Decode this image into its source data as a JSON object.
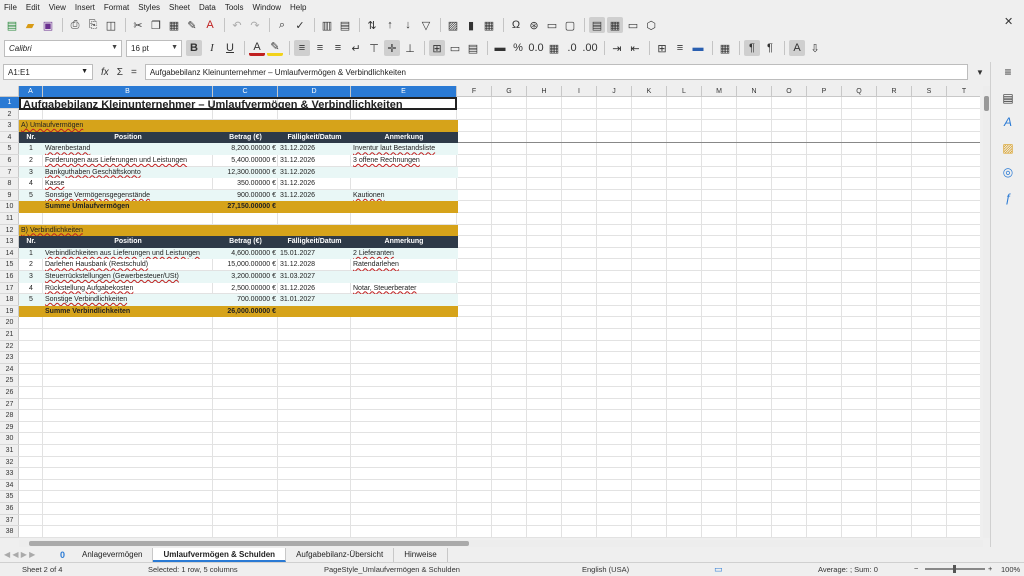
{
  "menu": [
    "File",
    "Edit",
    "View",
    "Insert",
    "Format",
    "Styles",
    "Sheet",
    "Data",
    "Tools",
    "Window",
    "Help"
  ],
  "toolbar": {
    "font_name": "Calibri",
    "font_size": "16 pt"
  },
  "formula_bar": {
    "name_box": "A1:E1",
    "fx_label": "fx",
    "sum_label": "Σ",
    "eq_label": "=",
    "content": "Aufgabebilanz Kleinunternehmer – Umlaufvermögen & Verbindlichkeiten"
  },
  "columns": [
    "A",
    "B",
    "C",
    "D",
    "E",
    "F",
    "G",
    "H",
    "I",
    "J",
    "K",
    "L",
    "M",
    "N",
    "O",
    "P",
    "Q",
    "R",
    "S",
    "T"
  ],
  "rows_count": 38,
  "sheet": {
    "title": "Aufgabebilanz Kleinunternehmer – Umlaufvermögen & Verbindlichkeiten",
    "sectionA": "A) Umlaufvermögen",
    "sectionB": "B) Verbindlichkeiten",
    "headers": [
      "Nr.",
      "Position",
      "Betrag (€)",
      "Fälligkeit/Datum",
      "Anmerkung"
    ],
    "umlauf": [
      {
        "nr": "1",
        "pos": "Warenbestand",
        "betrag": "8,200.00000 €",
        "datum": "31.12.2026",
        "anm": "Inventur laut Bestandsliste"
      },
      {
        "nr": "2",
        "pos": "Forderungen aus Lieferungen und Leistungen",
        "betrag": "5,400.00000 €",
        "datum": "31.12.2026",
        "anm": "3 offene Rechnungen"
      },
      {
        "nr": "3",
        "pos": "Bankguthaben Geschäftskonto",
        "betrag": "12,300.00000 €",
        "datum": "31.12.2026",
        "anm": ""
      },
      {
        "nr": "4",
        "pos": "Kasse",
        "betrag": "350.00000 €",
        "datum": "31.12.2026",
        "anm": ""
      },
      {
        "nr": "5",
        "pos": "Sonstige Vermögensgegenstände",
        "betrag": "900.00000 €",
        "datum": "31.12.2026",
        "anm": "Kautionen"
      }
    ],
    "sum_umlauf": {
      "label": "Summe Umlaufvermögen",
      "betrag": "27,150.00000 €"
    },
    "verb": [
      {
        "nr": "1",
        "pos": "Verbindlichkeiten aus Lieferungen und Leistungen",
        "betrag": "4,600.00000 €",
        "datum": "15.01.2027",
        "anm": "2 Lieferanten"
      },
      {
        "nr": "2",
        "pos": "Darlehen Hausbank (Restschuld)",
        "betrag": "15,000.00000 €",
        "datum": "31.12.2028",
        "anm": "Ratendarlehen"
      },
      {
        "nr": "3",
        "pos": "Steuerrückstellungen (Gewerbesteuer/USt)",
        "betrag": "3,200.00000 €",
        "datum": "31.03.2027",
        "anm": ""
      },
      {
        "nr": "4",
        "pos": "Rückstellung Aufgabekosten",
        "betrag": "2,500.00000 €",
        "datum": "31.12.2026",
        "anm": "Notar, Steuerberater"
      },
      {
        "nr": "5",
        "pos": "Sonstige Verbindlichkeiten",
        "betrag": "700.00000 €",
        "datum": "31.01.2027",
        "anm": ""
      }
    ],
    "sum_verb": {
      "label": "Summe Verbindlichkeiten",
      "betrag": "26,000.00000 €"
    }
  },
  "tabs": {
    "add": "0",
    "items": [
      "Anlagevermögen",
      "Umlaufvermögen & Schulden",
      "Aufgabebilanz-Übersicht",
      "Hinweise"
    ],
    "active_index": 1
  },
  "status": {
    "sheet": "Sheet 2 of 4",
    "selection": "Selected: 1 row, 5 columns",
    "pagestyle": "PageStyle_Umlaufvermögen & Schulden",
    "language": "English (USA)",
    "summary": "Average: ; Sum: 0",
    "zoom": "100%"
  },
  "colors": {
    "header_dark": "#2e3a48",
    "section_gold": "#d6a31a",
    "row_tint": "#e9f7f6",
    "select_blue": "#2a7ad4"
  }
}
